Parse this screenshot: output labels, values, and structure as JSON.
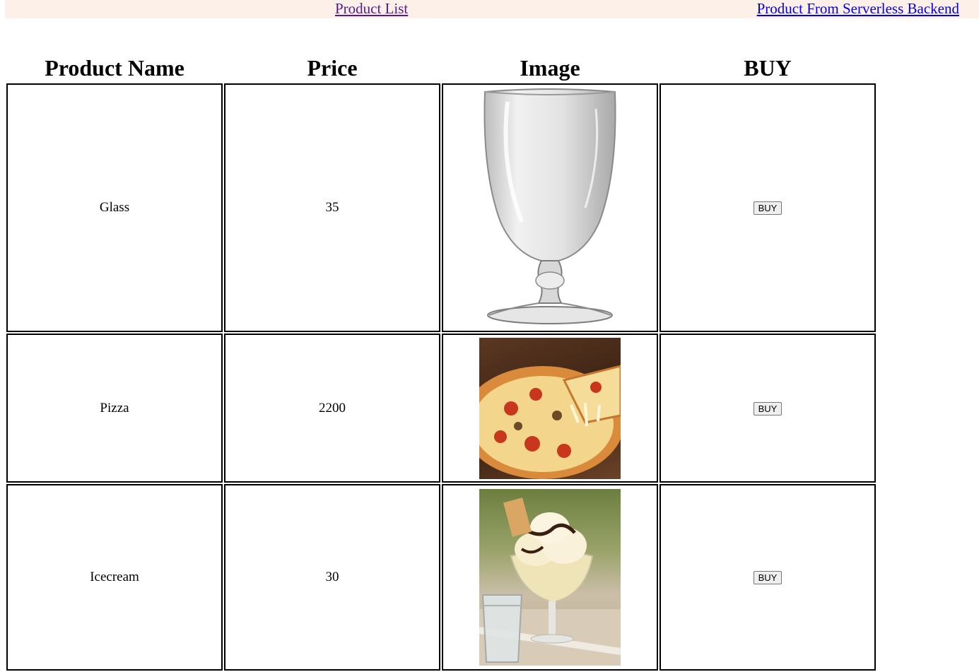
{
  "nav": {
    "product_list": "Product List",
    "serverless": "Product From Serverless Backend"
  },
  "table": {
    "headers": [
      "Product Name",
      "Price",
      "Image",
      "BUY"
    ],
    "rows": [
      {
        "name": "Glass",
        "price": "35",
        "image": "glass-image",
        "buy_label": "BUY"
      },
      {
        "name": "Pizza",
        "price": "2200",
        "image": "pizza-image",
        "buy_label": "BUY"
      },
      {
        "name": "Icecream",
        "price": "30",
        "image": "icecream-image",
        "buy_label": "BUY"
      }
    ]
  },
  "colors": {
    "nav_bg": "#fdf0e8",
    "link_visited": "#551a8b",
    "link": "#0000ee"
  }
}
